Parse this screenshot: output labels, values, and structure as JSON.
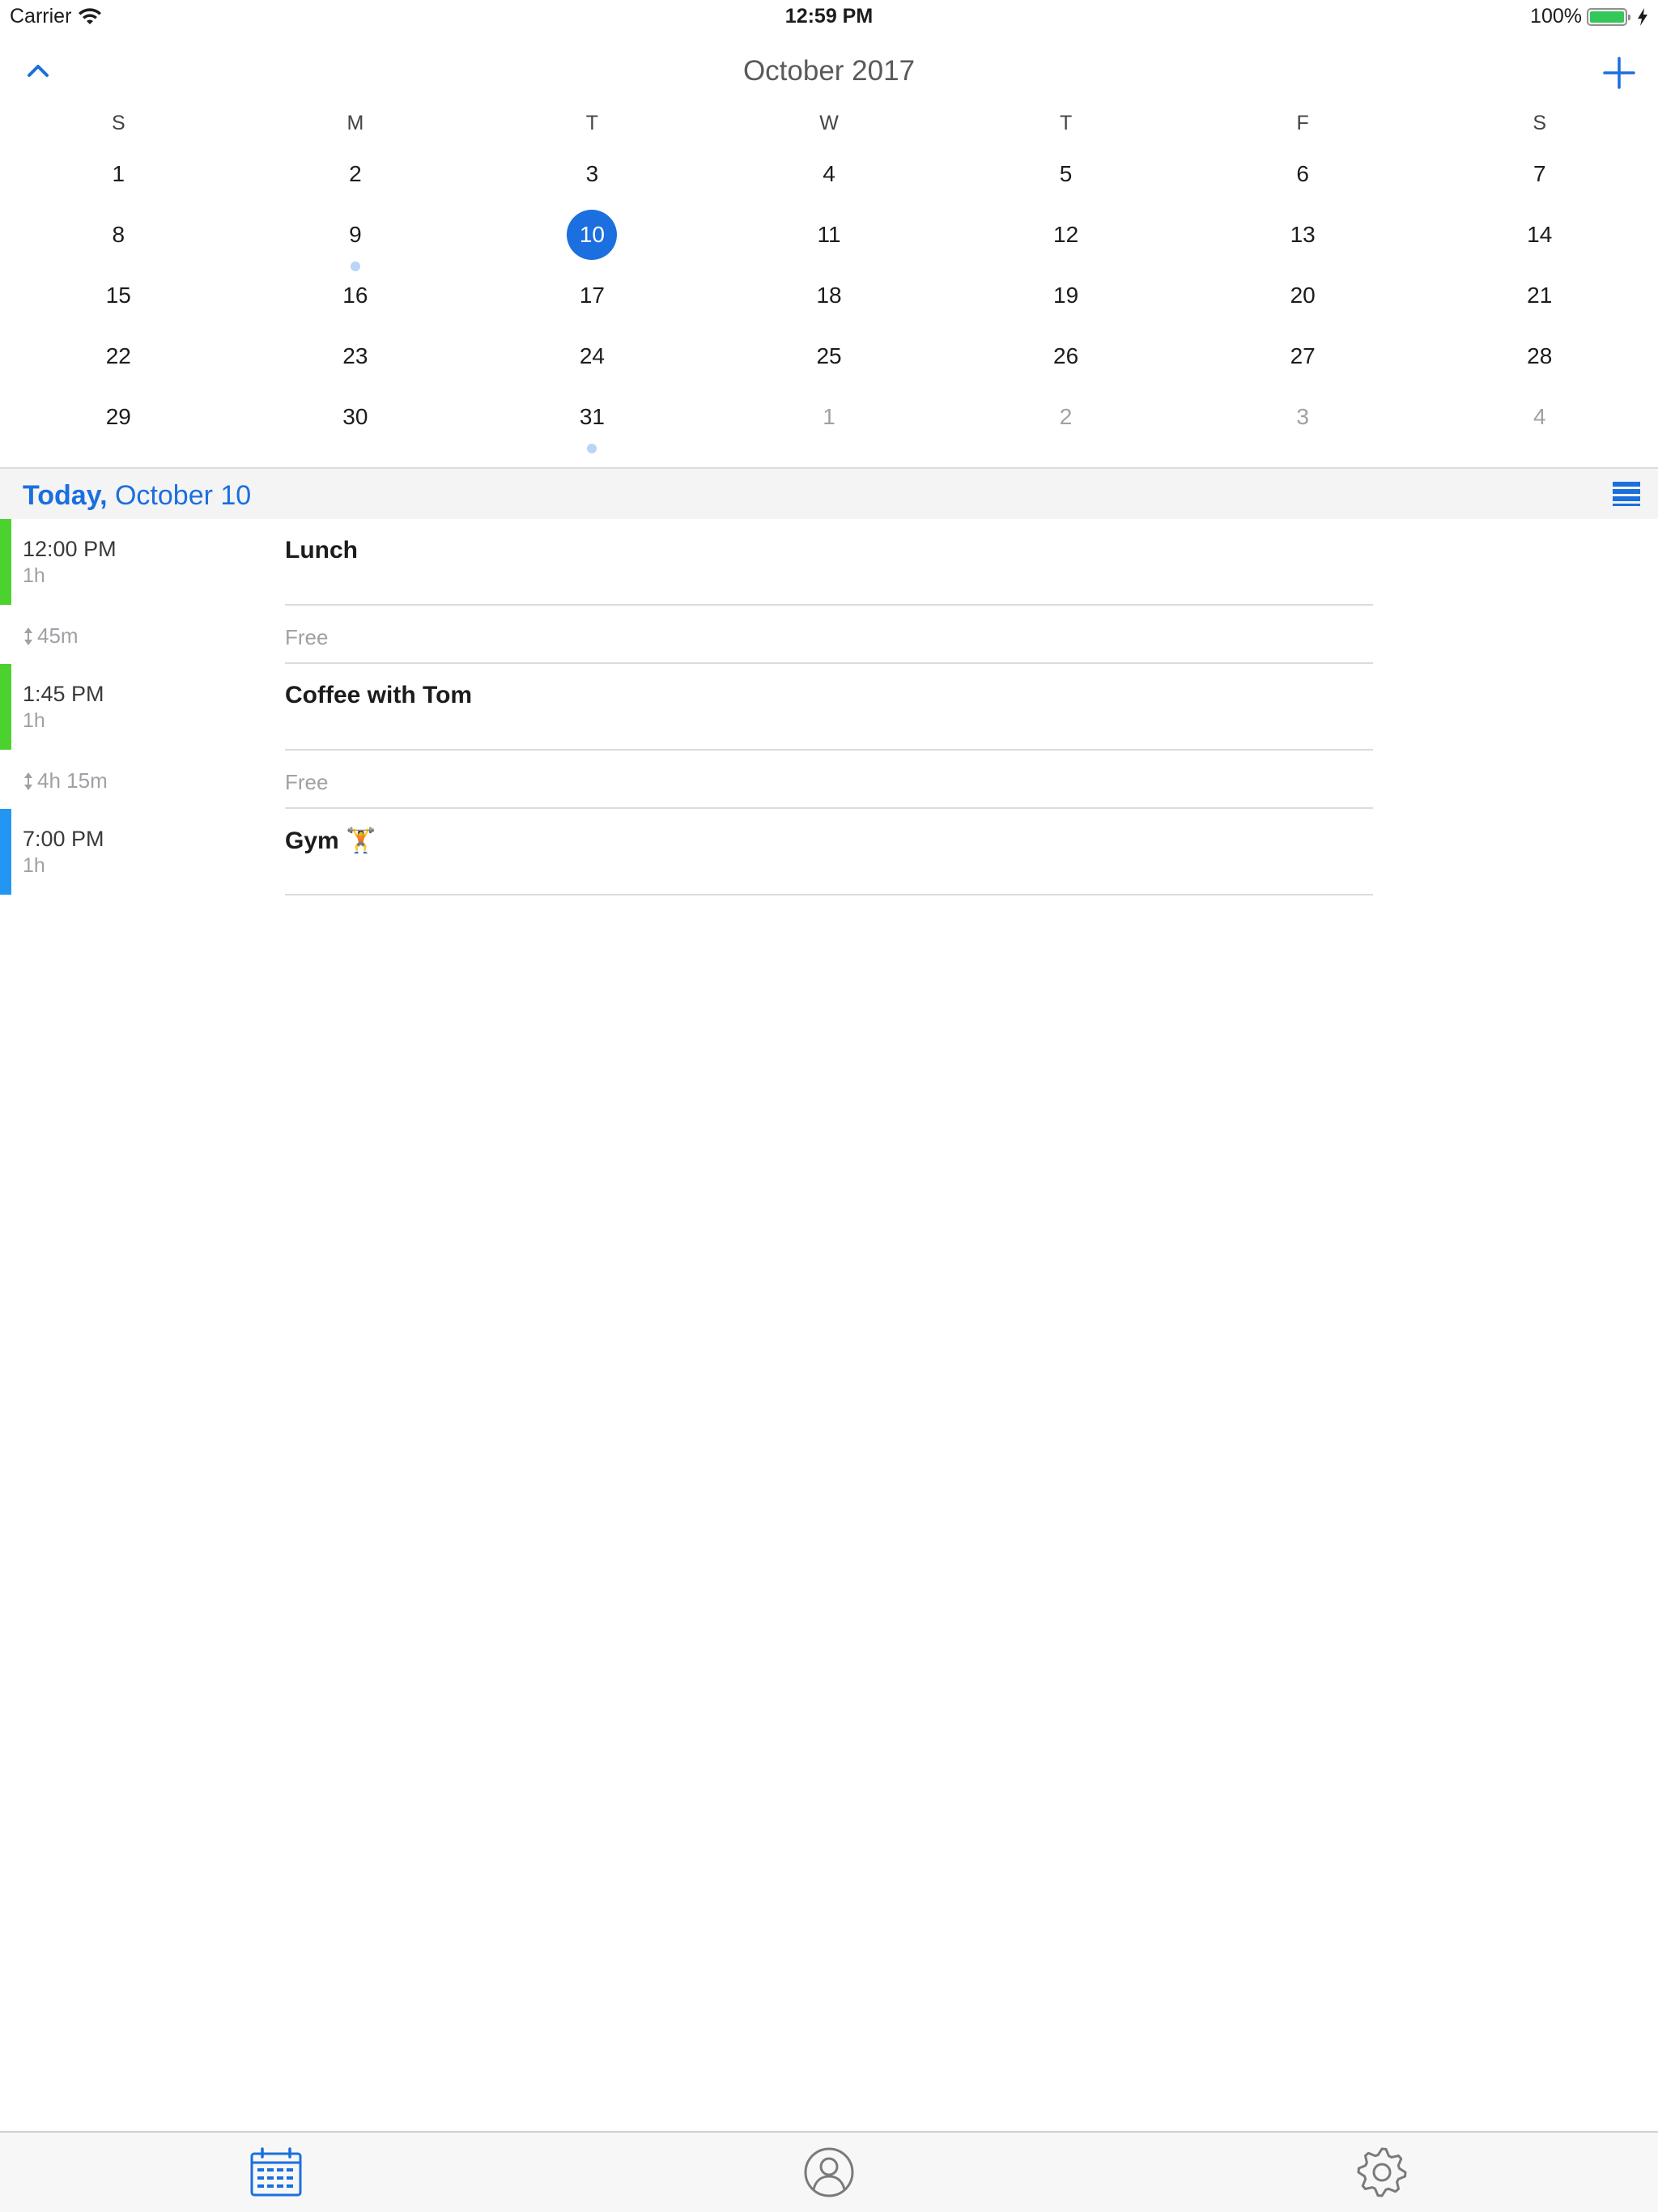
{
  "status_bar": {
    "carrier": "Carrier",
    "time": "12:59 PM",
    "battery": "100%",
    "battery_level": 1.0
  },
  "header": {
    "month_title": "October 2017"
  },
  "calendar": {
    "weekdays": [
      "S",
      "M",
      "T",
      "W",
      "T",
      "F",
      "S"
    ],
    "weeks": [
      [
        {
          "d": "1"
        },
        {
          "d": "2"
        },
        {
          "d": "3"
        },
        {
          "d": "4"
        },
        {
          "d": "5"
        },
        {
          "d": "6"
        },
        {
          "d": "7"
        }
      ],
      [
        {
          "d": "8"
        },
        {
          "d": "9",
          "dot": true
        },
        {
          "d": "10",
          "selected": true
        },
        {
          "d": "11"
        },
        {
          "d": "12"
        },
        {
          "d": "13"
        },
        {
          "d": "14"
        }
      ],
      [
        {
          "d": "15"
        },
        {
          "d": "16"
        },
        {
          "d": "17"
        },
        {
          "d": "18"
        },
        {
          "d": "19"
        },
        {
          "d": "20"
        },
        {
          "d": "21"
        }
      ],
      [
        {
          "d": "22"
        },
        {
          "d": "23"
        },
        {
          "d": "24"
        },
        {
          "d": "25"
        },
        {
          "d": "26"
        },
        {
          "d": "27"
        },
        {
          "d": "28"
        }
      ],
      [
        {
          "d": "29"
        },
        {
          "d": "30"
        },
        {
          "d": "31",
          "dot": true
        },
        {
          "d": "1",
          "other": true
        },
        {
          "d": "2",
          "other": true
        },
        {
          "d": "3",
          "other": true
        },
        {
          "d": "4",
          "other": true
        }
      ]
    ]
  },
  "day_header": {
    "today": "Today,",
    "date": " October 10"
  },
  "events": [
    {
      "type": "event",
      "time": "12:00 PM",
      "duration": "1h",
      "title": "Lunch",
      "color": "#4cd22e"
    },
    {
      "type": "free",
      "gap": "45m",
      "label": "Free"
    },
    {
      "type": "event",
      "time": "1:45 PM",
      "duration": "1h",
      "title": "Coffee with Tom",
      "color": "#4cd22e"
    },
    {
      "type": "free",
      "gap": "4h 15m",
      "label": "Free"
    },
    {
      "type": "event",
      "time": "7:00 PM",
      "duration": "1h",
      "title": "Gym 🏋",
      "color": "#2196f3"
    }
  ],
  "colors": {
    "accent": "#1b6fde",
    "event_dot": "#b9d4f5"
  },
  "tabs": [
    {
      "icon": "calendar-icon",
      "active": true
    },
    {
      "icon": "profile-icon",
      "active": false
    },
    {
      "icon": "settings-gear-icon",
      "active": false
    }
  ]
}
